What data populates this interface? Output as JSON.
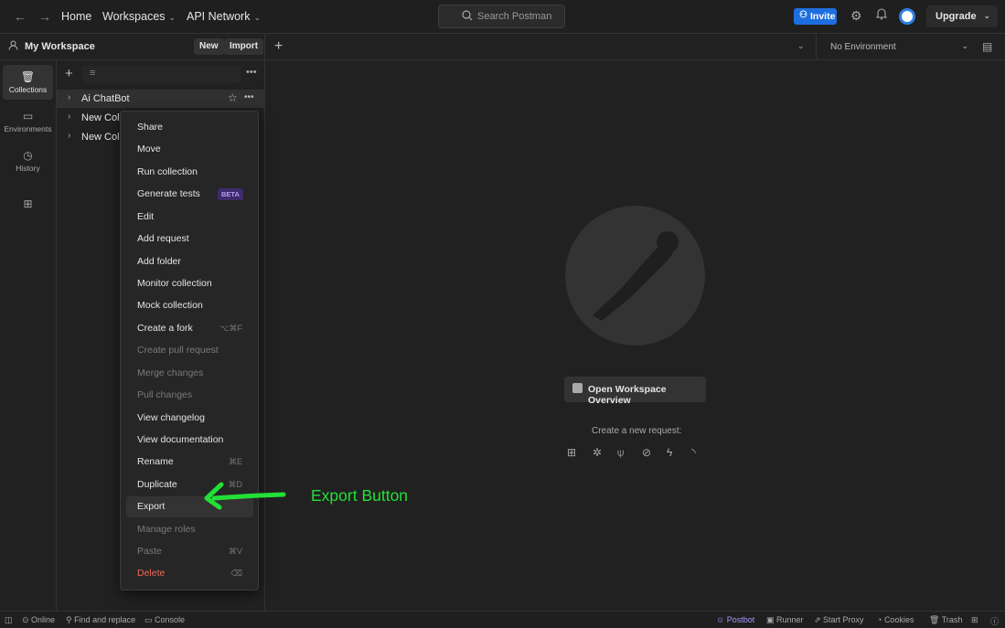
{
  "header": {
    "back_icon": "arrow-left-icon",
    "forward_icon": "arrow-right-icon",
    "home": "Home",
    "workspaces": "Workspaces",
    "api_network": "API Network",
    "search_placeholder": "Search Postman",
    "invite": "Invite",
    "upgrade": "Upgrade"
  },
  "workspace": {
    "title": "My Workspace",
    "new": "New",
    "import": "Import"
  },
  "rail": {
    "collections": "Collections",
    "environments": "Environments",
    "history": "History"
  },
  "collections": [
    {
      "name": "Ai ChatBot"
    },
    {
      "name": "New Colle"
    },
    {
      "name": "New Colle"
    }
  ],
  "environment": {
    "selected": "No Environment"
  },
  "menu": {
    "share": "Share",
    "move": "Move",
    "run_collection": "Run collection",
    "generate_tests": "Generate tests",
    "beta": "BETA",
    "edit": "Edit",
    "add_request": "Add request",
    "add_folder": "Add folder",
    "monitor_collection": "Monitor collection",
    "mock_collection": "Mock collection",
    "create_fork": "Create a fork",
    "create_fork_sc": "⌥⌘F",
    "create_pull_request": "Create pull request",
    "merge_changes": "Merge changes",
    "pull_changes": "Pull changes",
    "view_changelog": "View changelog",
    "view_documentation": "View documentation",
    "rename": "Rename",
    "rename_sc": "⌘E",
    "duplicate": "Duplicate",
    "duplicate_sc": "⌘D",
    "export": "Export",
    "manage_roles": "Manage roles",
    "paste": "Paste",
    "paste_sc": "⌘V",
    "delete": "Delete",
    "delete_sc": "⌫"
  },
  "main": {
    "open_overview": "Open Workspace Overview",
    "create_request": "Create a new request:"
  },
  "annotation": "Export Button",
  "statusbar": {
    "online": "Online",
    "find_replace": "Find and replace",
    "console": "Console",
    "postbot": "Postbot",
    "runner": "Runner",
    "start_proxy": "Start Proxy",
    "cookies": "Cookies",
    "trash": "Trash"
  },
  "colors": {
    "accent": "#1d6fe0",
    "annotation": "#22e036",
    "danger": "#ef6a5a"
  }
}
